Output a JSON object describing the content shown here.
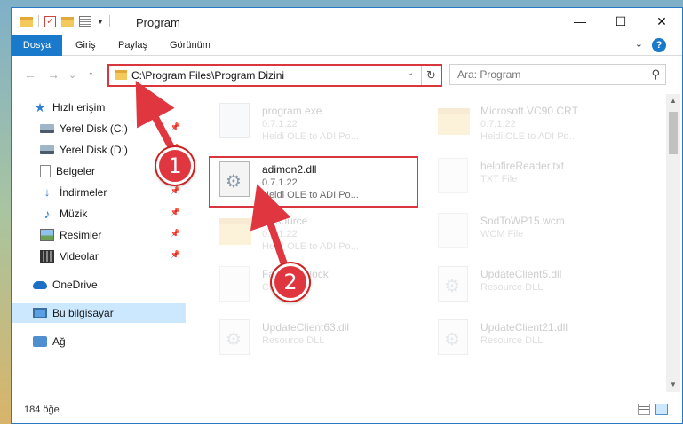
{
  "window": {
    "title": "Program",
    "controls": {
      "minimize": "—",
      "maximize": "☐",
      "close": "✕"
    }
  },
  "ribbon": {
    "tabs": [
      "Dosya",
      "Giriş",
      "Paylaş",
      "Görünüm"
    ],
    "help": "?",
    "expand": "⌄"
  },
  "nav": {
    "back": "←",
    "forward": "→",
    "recent": "⌄",
    "up": "↑",
    "address": "C:\\Program Files\\Program Dizini",
    "address_drop": "⌄",
    "refresh": "↻",
    "search_placeholder": "Ara: Program",
    "search_glyph": "⚲"
  },
  "sidebar": {
    "pin_glyph": "📌",
    "items": [
      {
        "label": "Hızlı erişim",
        "icon": "star-icon",
        "glyph": "★",
        "pinned": false
      },
      {
        "label": "Yerel Disk (C:)",
        "icon": "disk-icon",
        "pinned": true
      },
      {
        "label": "Yerel Disk (D:)",
        "icon": "disk-icon",
        "pinned": true
      },
      {
        "label": "Belgeler",
        "icon": "document-icon",
        "pinned": true
      },
      {
        "label": "İndirmeler",
        "icon": "download-icon",
        "glyph": "↓",
        "pinned": true
      },
      {
        "label": "Müzik",
        "icon": "music-icon",
        "glyph": "♪",
        "pinned": true
      },
      {
        "label": "Resimler",
        "icon": "pictures-icon",
        "pinned": true
      },
      {
        "label": "Videolar",
        "icon": "video-icon",
        "pinned": true
      },
      {
        "label": "OneDrive",
        "icon": "cloud-icon",
        "pinned": false
      },
      {
        "label": "Bu bilgisayar",
        "icon": "computer-icon",
        "pinned": false,
        "selected": true
      },
      {
        "label": "Ağ",
        "icon": "network-icon",
        "pinned": false
      }
    ]
  },
  "files": {
    "left": [
      {
        "name": "program.exe",
        "meta1": "0.7.1.22",
        "meta2": "Heidi OLE to ADI Po...",
        "type": "exe"
      },
      {
        "name": "adimon2.dll",
        "meta1": "0.7.1.22",
        "meta2": "Heidi OLE to ADI Po...",
        "type": "dll",
        "highlighted": true
      },
      {
        "name": "Resource",
        "meta1": "0.7.1.22",
        "meta2": "Heidi OLE to ADI Po...",
        "type": "folder"
      },
      {
        "name": "FastPack.lock",
        "meta1": "CR",
        "meta2": "",
        "type": "page"
      },
      {
        "name": "UpdateClient63.dll",
        "meta1": "Resource DLL",
        "meta2": "",
        "type": "dll"
      }
    ],
    "right": [
      {
        "name": "Microsoft.VC90.CRT",
        "meta1": "0.7.1.22",
        "meta2": "Heidi OLE to ADI Po...",
        "type": "folder"
      },
      {
        "name": "helpfireReader.txt",
        "meta1": "TXT File",
        "meta2": "",
        "type": "page"
      },
      {
        "name": "SndToWP15.wcm",
        "meta1": "WCM File",
        "meta2": "",
        "type": "page"
      },
      {
        "name": "UpdateClient5.dll",
        "meta1": "Resource DLL",
        "meta2": "",
        "type": "dll"
      },
      {
        "name": "UpdateClient21.dll",
        "meta1": "Resource DLL",
        "meta2": "",
        "type": "dll"
      }
    ]
  },
  "status": {
    "count": "184 öğe"
  },
  "annotations": {
    "step1": "1",
    "step2": "2",
    "color": "#e0363f"
  },
  "colors": {
    "accent": "#1979ca",
    "highlight": "#d9363e",
    "selection": "#cce8ff"
  }
}
